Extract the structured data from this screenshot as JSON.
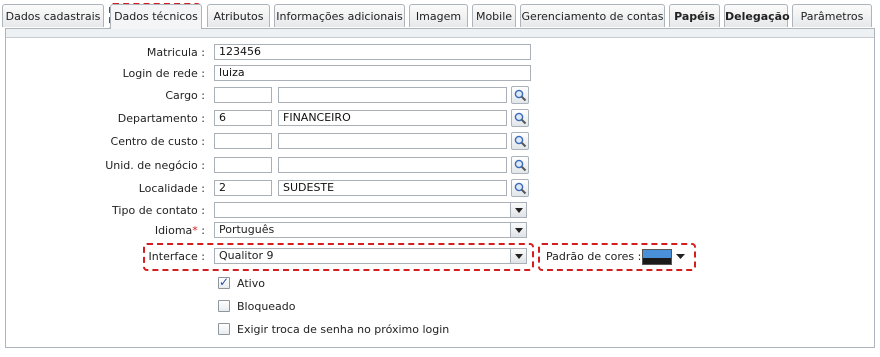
{
  "tabs": [
    {
      "label": "Dados cadastrais",
      "active": false,
      "bold": false
    },
    {
      "label": "Dados técnicos",
      "active": true,
      "bold": false
    },
    {
      "label": "Atributos",
      "active": false,
      "bold": false
    },
    {
      "label": "Informações adicionais",
      "active": false,
      "bold": false
    },
    {
      "label": "Imagem",
      "active": false,
      "bold": false
    },
    {
      "label": "Mobile",
      "active": false,
      "bold": false
    },
    {
      "label": "Gerenciamento de contas",
      "active": false,
      "bold": false
    },
    {
      "label": "Papéis",
      "active": false,
      "bold": true
    },
    {
      "label": "Delegação",
      "active": false,
      "bold": true
    },
    {
      "label": "Parâmetros",
      "active": false,
      "bold": false
    }
  ],
  "form": {
    "matricula": {
      "label": "Matricula :",
      "value": "123456"
    },
    "login": {
      "label": "Login de rede :",
      "value": "luiza"
    },
    "cargo": {
      "label": "Cargo :",
      "code": "",
      "name": ""
    },
    "departamento": {
      "label": "Departamento :",
      "code": "6",
      "name": "FINANCEIRO"
    },
    "centro_custo": {
      "label": "Centro de custo :",
      "code": "",
      "name": ""
    },
    "unid_negocio": {
      "label": "Unid. de negócio :",
      "code": "",
      "name": ""
    },
    "localidade": {
      "label": "Localidade :",
      "code": "2",
      "name": "SUDESTE"
    },
    "tipo_contato": {
      "label": "Tipo de contato :",
      "value": ""
    },
    "idioma": {
      "label": "Idioma",
      "required_mark": "*",
      "suffix": " :",
      "value": "Português"
    },
    "interface": {
      "label": "Interface :",
      "value": "Qualitor 9"
    },
    "padrao_cores": {
      "label": "Padrão de cores :",
      "colors": [
        "#4a90d9",
        "#1a1a1a"
      ]
    }
  },
  "checkboxes": [
    {
      "label": "Ativo",
      "checked": true
    },
    {
      "label": "Bloqueado",
      "checked": false
    },
    {
      "label": "Exigir troca de senha no próximo login",
      "checked": false
    }
  ],
  "accent": "#d21e1e"
}
